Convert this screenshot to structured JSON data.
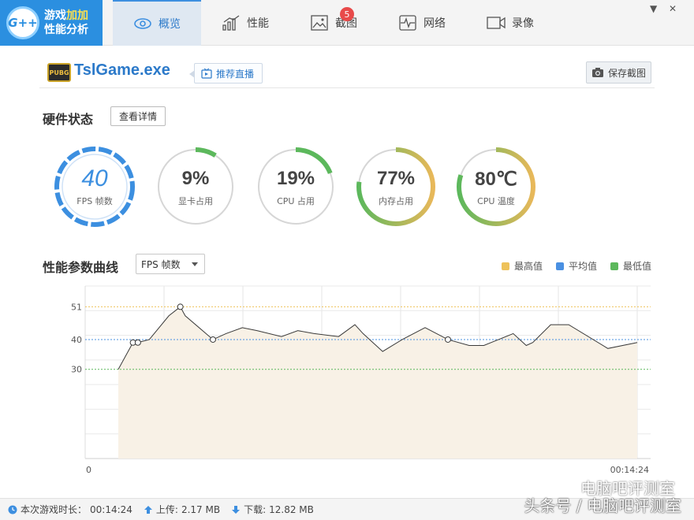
{
  "app": {
    "logo_line1": "游戏",
    "logo_line1_hl": "加加",
    "logo_line2": "性能分析",
    "logo_badge": "G++"
  },
  "tabs": [
    {
      "label": "概览",
      "icon": "eye-icon",
      "active": true
    },
    {
      "label": "性能",
      "icon": "bar-chart-icon"
    },
    {
      "label": "截图",
      "icon": "image-icon",
      "badge": "5"
    },
    {
      "label": "网络",
      "icon": "pulse-icon"
    },
    {
      "label": "录像",
      "icon": "video-icon"
    }
  ],
  "window": {
    "minimize": "▼",
    "close": "✕"
  },
  "game": {
    "icon_text": "PUBG",
    "name": "TslGame.exe",
    "recommend_label": "推荐直播",
    "save_shot_label": "保存截图"
  },
  "hardware": {
    "title": "硬件状态",
    "detail_button": "查看详情",
    "gauges": [
      {
        "value": "40",
        "label": "FPS 帧数",
        "fill": 1.0,
        "color": "#3c8fe0"
      },
      {
        "value": "9%",
        "label": "显卡占用",
        "fill": 0.09,
        "color": "#5cb85c"
      },
      {
        "value": "19%",
        "label": "CPU 占用",
        "fill": 0.19,
        "color": "#5cb85c"
      },
      {
        "value": "77%",
        "label": "内存占用",
        "fill": 0.77,
        "color": "#e0b050"
      },
      {
        "value": "80℃",
        "label": "CPU 温度",
        "fill": 0.8,
        "color": "#e0b050"
      }
    ]
  },
  "performance": {
    "title": "性能参数曲线",
    "selected_metric": "FPS 帧数",
    "legend": [
      {
        "label": "最高值",
        "color": "#eec25a"
      },
      {
        "label": "平均值",
        "color": "#4a90e2"
      },
      {
        "label": "最低值",
        "color": "#5cb85c"
      }
    ]
  },
  "chart_data": {
    "type": "area",
    "x_start_label": "0",
    "x_end_label": "00:14:24",
    "y_ticks": [
      30,
      40,
      51
    ],
    "ylim": [
      0,
      58
    ],
    "max": 51,
    "avg": 40,
    "min": 30,
    "x": [
      0,
      9,
      12,
      19,
      31,
      38,
      41,
      58,
      66,
      76,
      85,
      100,
      110,
      120,
      135,
      145,
      150,
      162,
      174,
      188,
      202,
      215,
      224,
      242,
      250,
      254,
      265,
      276,
      300,
      318
    ],
    "values": [
      30,
      39,
      39,
      40,
      48,
      51,
      48,
      40,
      42,
      44,
      43,
      41,
      43,
      42,
      41,
      45,
      42,
      36,
      40,
      44,
      40,
      38,
      38,
      42,
      38,
      39,
      45,
      45,
      37,
      39
    ],
    "series": [
      {
        "values": [
          30,
          39,
          39,
          40,
          48,
          51,
          48,
          40,
          42,
          44,
          43,
          41,
          43,
          42,
          41,
          45,
          42,
          36,
          40,
          44,
          40,
          38,
          38,
          42,
          38,
          39,
          45,
          45,
          37,
          39
        ]
      }
    ],
    "markers": [
      1,
      2,
      5,
      7,
      20
    ],
    "x_max": 318
  },
  "status": {
    "playtime_label": "本次游戏时长：",
    "playtime": "00:14:24",
    "upload_label": "上传:",
    "upload": "2.17 MB",
    "download_label": "下载:",
    "download": "12.82 MB"
  },
  "watermark": {
    "line1": "电脑吧评测室",
    "line2": "头条号 / 电脑吧评测室"
  }
}
